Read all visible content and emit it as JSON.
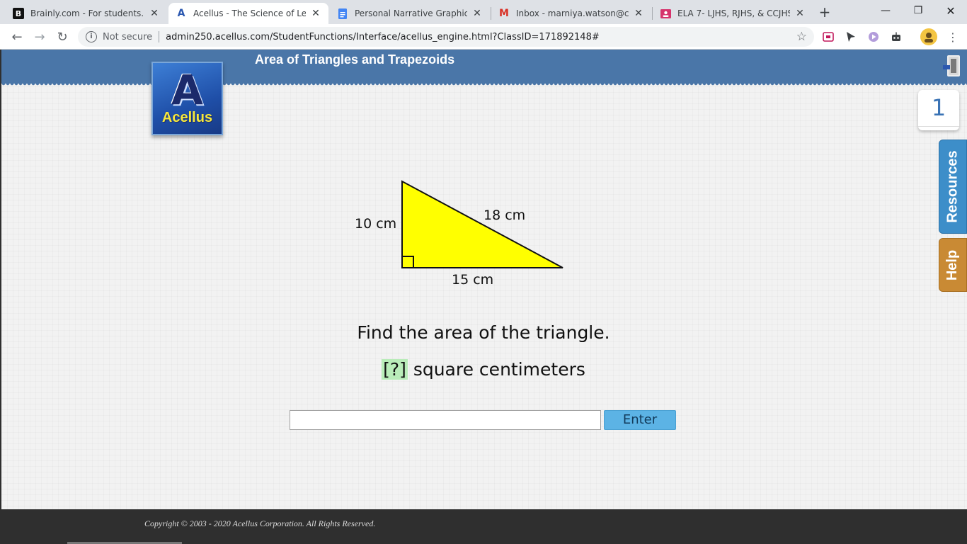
{
  "browser": {
    "tabs": [
      {
        "title": "Brainly.com - For students. By",
        "favicon": "B"
      },
      {
        "title": "Acellus - The Science of Learni",
        "favicon": "A"
      },
      {
        "title": "Personal Narrative Graphic Org",
        "favicon": "doc"
      },
      {
        "title": "Inbox - marniya.watson@cone",
        "favicon": "M"
      },
      {
        "title": "ELA 7- LJHS, RJHS, & CCJHS",
        "favicon": "cls"
      }
    ],
    "security_label": "Not secure",
    "url": "admin250.acellus.com/StudentFunctions/Interface/acellus_engine.html?ClassID=171892148#"
  },
  "header": {
    "lesson_title": "Area of Triangles and Trapezoids",
    "logo_text": "Acellus"
  },
  "problem": {
    "label_height": "10 cm",
    "label_hypotenuse": "18 cm",
    "label_base": "15 cm",
    "question": "Find the area of the triangle.",
    "blank": "[?]",
    "unit_text": " square centimeters",
    "triangle_fill": "#ffff00"
  },
  "answer": {
    "input_value": "",
    "enter_label": "Enter"
  },
  "sidebar": {
    "page_number": "1",
    "resources_label": "Resources",
    "help_label": "Help",
    "resources_color": "#3d8ec9",
    "help_color": "#c98a34"
  },
  "footer": {
    "copyright": "Copyright © 2003 - 2020 Acellus Corporation.  All Rights Reserved."
  }
}
